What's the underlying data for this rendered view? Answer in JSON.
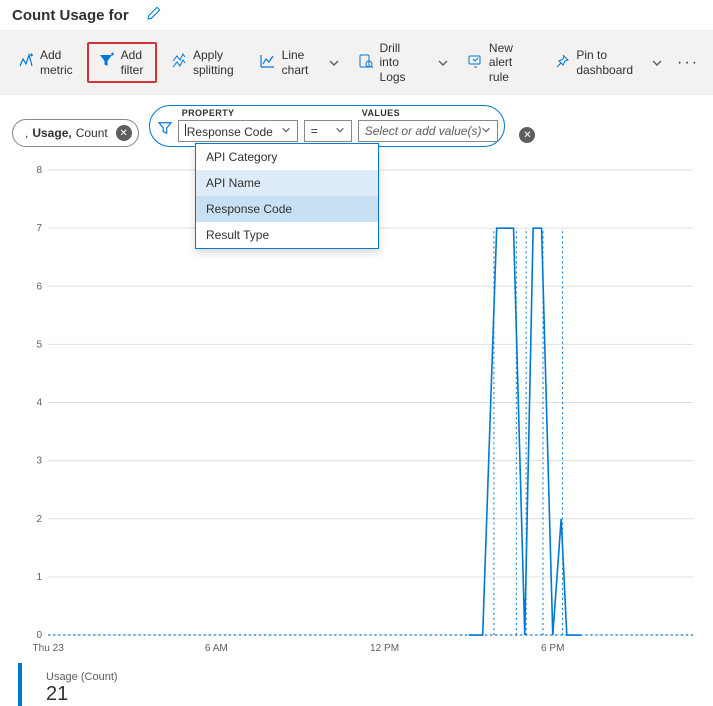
{
  "header": {
    "title": "Count Usage for"
  },
  "toolbar": {
    "add_metric": "Add metric",
    "add_filter": "Add filter",
    "apply_splitting": "Apply splitting",
    "line_chart": "Line chart",
    "drill_logs": "Drill into Logs",
    "new_alert": "New alert rule",
    "pin_dash": "Pin to dashboard"
  },
  "metric_pill": {
    "prefix": ", ",
    "name": "Usage,",
    "agg": " Count"
  },
  "filter": {
    "property_label": "PROPERTY",
    "property_value": "Response Code",
    "operator": "=",
    "values_label": "VALUES",
    "values_placeholder": "Select or add value(s)",
    "options": [
      "API Category",
      "API Name",
      "Response Code",
      "Result Type"
    ],
    "hover_index": 1,
    "selected_index": 2
  },
  "chart_data": {
    "type": "line",
    "ylabel": "",
    "xlabel": "",
    "ylim": [
      0,
      8
    ],
    "y_ticks": [
      0,
      1,
      2,
      3,
      4,
      5,
      6,
      7,
      8
    ],
    "x_ticks": [
      "Thu 23",
      "6 AM",
      "12 PM",
      "6 PM"
    ],
    "series": [
      {
        "name": "Usage (Count)",
        "color": "#0078d4",
        "x": [
          0,
          1,
          2,
          3,
          4,
          5,
          6,
          7,
          8,
          9,
          10,
          11,
          12,
          13,
          14,
          15,
          15.5,
          16,
          16.3,
          16.6,
          17,
          17.3,
          17.6,
          18,
          18.3,
          18.5,
          19,
          20,
          21,
          22,
          23
        ],
        "values": [
          0,
          0,
          0,
          0,
          0,
          0,
          0,
          0,
          0,
          0,
          0,
          0,
          0,
          0,
          0,
          0,
          0,
          7,
          7,
          7,
          0,
          7,
          7,
          0,
          2,
          0,
          0,
          0,
          0,
          0,
          0
        ]
      }
    ]
  },
  "legend": {
    "label": "Usage (Count)",
    "value": "21"
  }
}
